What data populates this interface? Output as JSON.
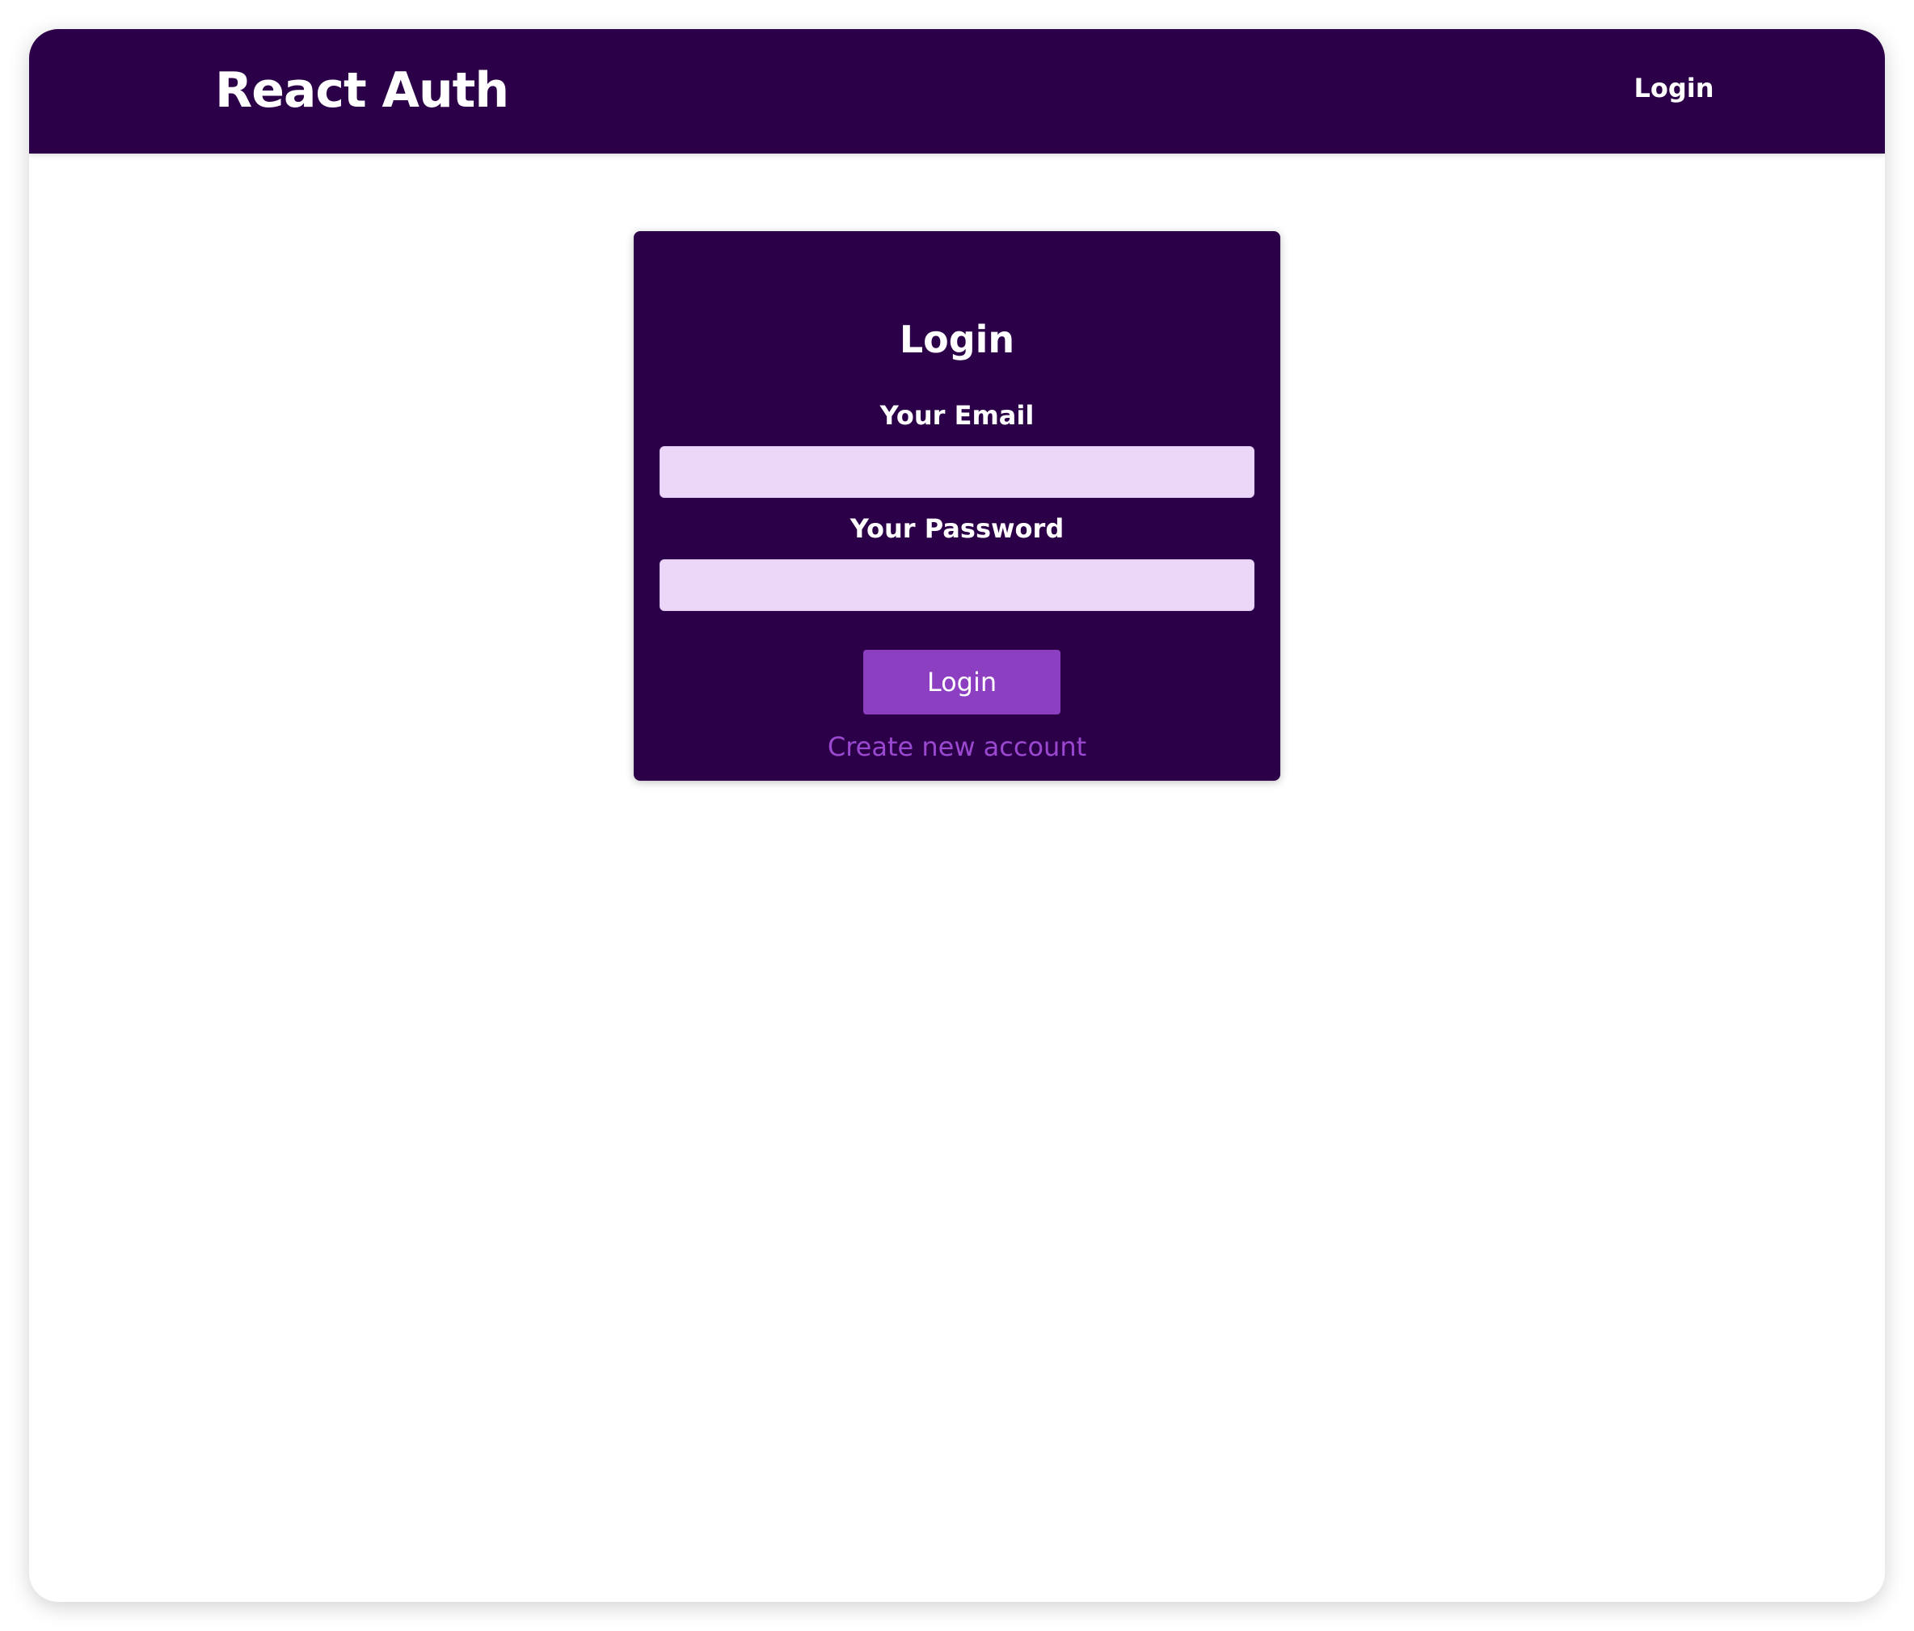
{
  "header": {
    "brand": "React Auth",
    "nav_login": "Login"
  },
  "auth_form": {
    "title": "Login",
    "email_label": "Your Email",
    "email_value": "",
    "password_label": "Your Password",
    "password_value": "",
    "submit_label": "Login",
    "toggle_link": "Create new account"
  },
  "colors": {
    "header_bg": "#2c0049",
    "card_bg": "#2c0049",
    "input_bg": "#ecd7f9",
    "button_bg": "#8c3fc0",
    "link_color": "#9a48d0"
  }
}
